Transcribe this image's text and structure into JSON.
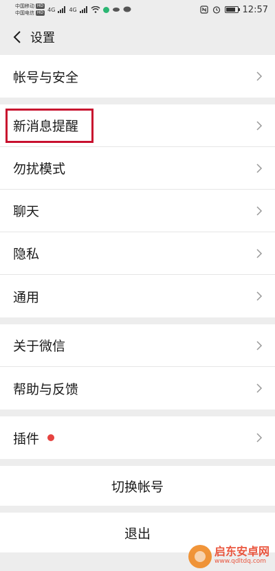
{
  "status_bar": {
    "carrier1": "中国移动",
    "carrier2": "中国电信",
    "hd": "HD",
    "net": "4G",
    "time": "12:57",
    "battery_percent": 85
  },
  "navbar": {
    "title": "设置"
  },
  "groups": [
    {
      "items": [
        {
          "label": "帐号与安全"
        }
      ]
    },
    {
      "items": [
        {
          "label": "新消息提醒"
        },
        {
          "label": "勿扰模式"
        },
        {
          "label": "聊天"
        },
        {
          "label": "隐私"
        },
        {
          "label": "通用"
        }
      ]
    },
    {
      "items": [
        {
          "label": "关于微信"
        },
        {
          "label": "帮助与反馈"
        }
      ]
    },
    {
      "items": [
        {
          "label": "插件"
        }
      ]
    }
  ],
  "actions": {
    "switch_account": "切换帐号",
    "logout": "退出"
  },
  "watermark": {
    "title": "启东安卓网",
    "url": "www.qdltdq.com"
  },
  "colors": {
    "highlight": "#c8102e",
    "badge": "#e64340",
    "accent": "#2bb673"
  }
}
